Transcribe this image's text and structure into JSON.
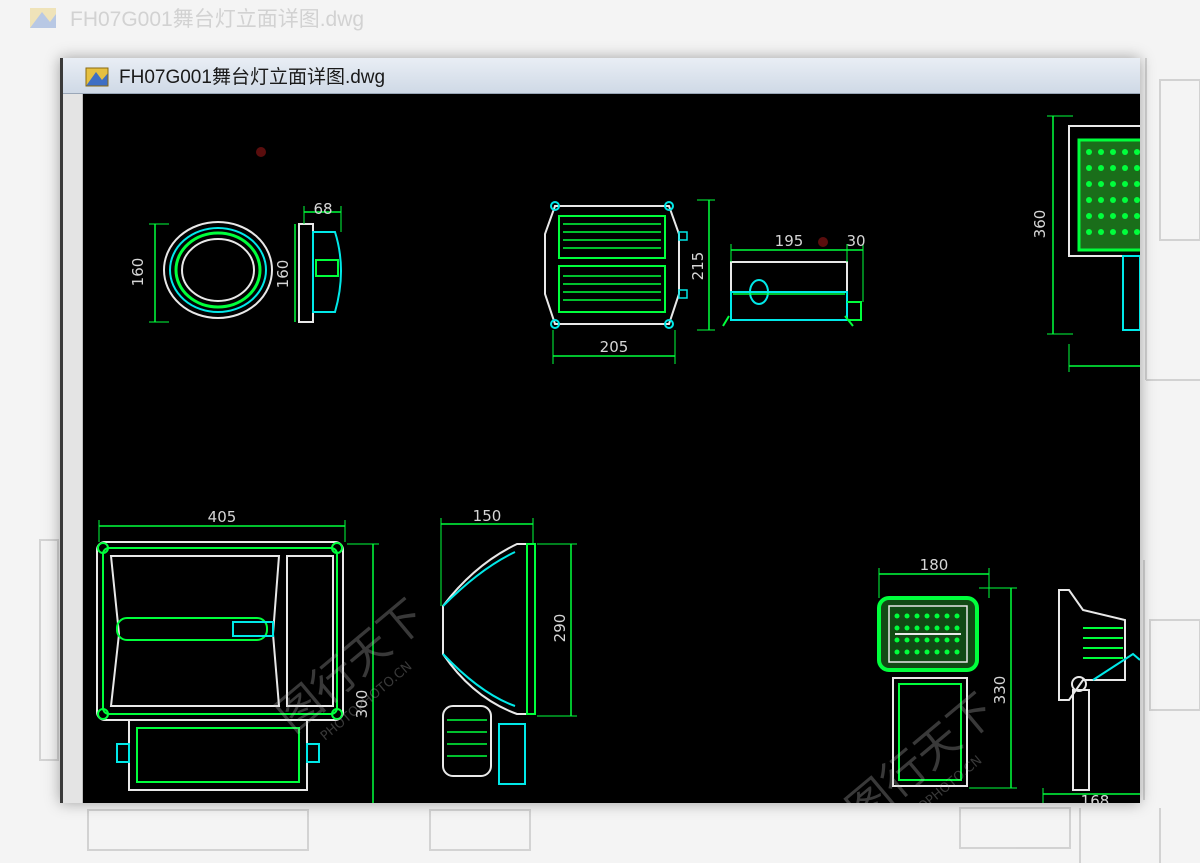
{
  "background_window": {
    "title": "FH07G001舞台灯立面详图.dwg"
  },
  "window": {
    "title": "FH07G001舞台灯立面详图.dwg",
    "file_icon": "dwg-file-icon"
  },
  "drawing": {
    "views": [
      {
        "id": "round-lamp",
        "dims": [
          "160",
          "68",
          "160"
        ]
      },
      {
        "id": "box-lamp",
        "dims": [
          "215",
          "205",
          "195",
          "30"
        ]
      },
      {
        "id": "tall-lamp",
        "dims": [
          "360"
        ]
      },
      {
        "id": "floodlight-front",
        "dims": [
          "405",
          "300"
        ]
      },
      {
        "id": "floodlight-side",
        "dims": [
          "150",
          "290"
        ]
      },
      {
        "id": "small-floodlight",
        "dims": [
          "180",
          "330"
        ]
      },
      {
        "id": "small-floodlight-side",
        "dims": [
          "168"
        ]
      }
    ]
  },
  "watermark": {
    "text": "图行天下",
    "sub": "PHOTOPHOTO.CN"
  },
  "colors": {
    "accent_green": "#00ff3c",
    "cyan": "#00e8e8",
    "white": "#e8e8e8",
    "dim": "#d6d6d6"
  }
}
